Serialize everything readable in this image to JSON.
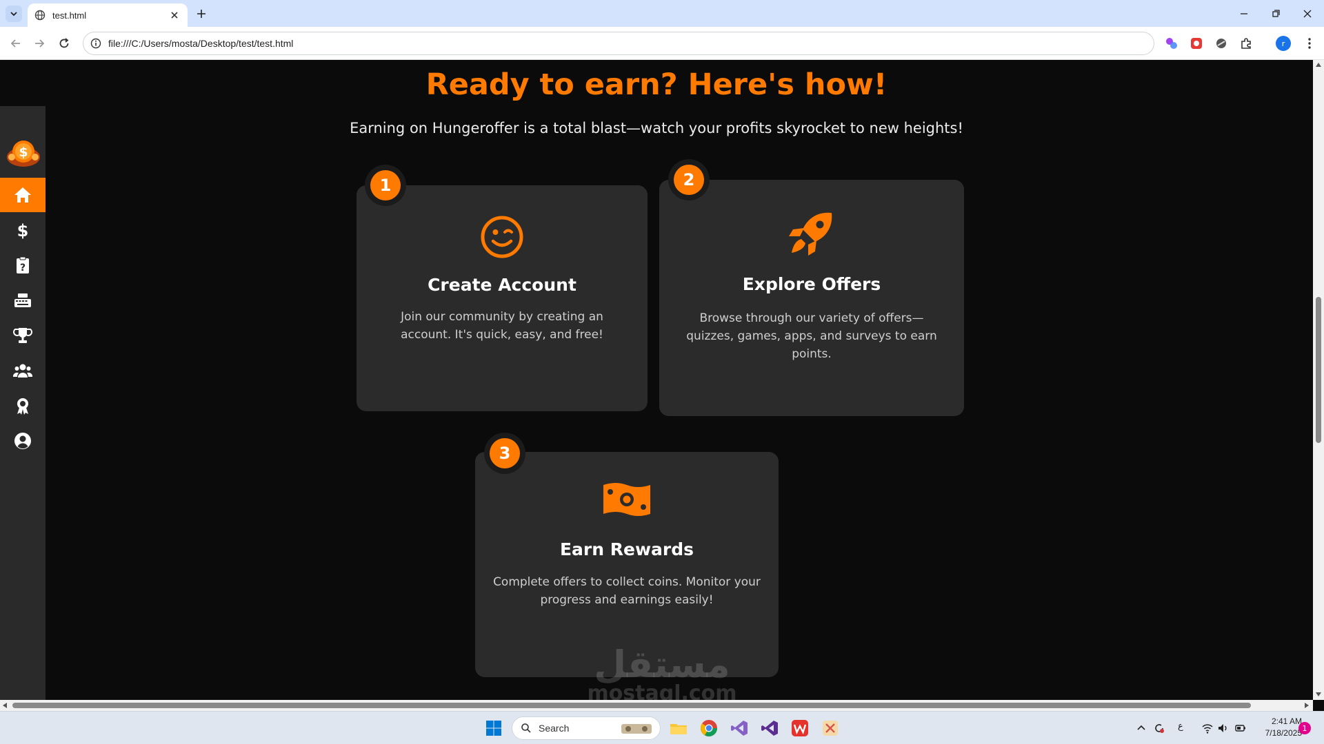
{
  "browser": {
    "tab_title": "test.html",
    "url": "file:///C:/Users/mosta/Desktop/test/test.html",
    "profile_initial": "r"
  },
  "page": {
    "heading": "Ready to earn? Here's how!",
    "subheading": "Earning on Hungeroffer is a total blast—watch your profits skyrocket to new heights!",
    "accent_color": "#ff7a00"
  },
  "sidebar": {
    "items": [
      {
        "icon": "home-icon",
        "active": true
      },
      {
        "icon": "dollar-icon",
        "active": false
      },
      {
        "icon": "quiz-clipboard-icon",
        "active": false
      },
      {
        "icon": "keyboard-icon",
        "active": false
      },
      {
        "icon": "trophy-icon",
        "active": false
      },
      {
        "icon": "users-icon",
        "active": false
      },
      {
        "icon": "award-icon",
        "active": false
      },
      {
        "icon": "user-circle-icon",
        "active": false
      }
    ]
  },
  "steps": [
    {
      "number": "1",
      "icon": "wink-smile-icon",
      "title": "Create Account",
      "text": "Join our community by creating an account. It's quick, easy, and free!"
    },
    {
      "number": "2",
      "icon": "rocket-icon",
      "title": "Explore Offers",
      "text": "Browse through our variety of offers—quizzes, games, apps, and surveys to earn points."
    },
    {
      "number": "3",
      "icon": "money-bill-icon",
      "title": "Earn Rewards",
      "text": "Complete offers to collect coins. Monitor your progress and earnings easily!"
    }
  ],
  "watermark": {
    "arabic": "مستقل",
    "latin": "mostaql.com"
  },
  "taskbar": {
    "search_label": "Search",
    "time": "2:41 AM",
    "date": "7/18/2025",
    "notification_count": "1",
    "input_language": "ع"
  }
}
